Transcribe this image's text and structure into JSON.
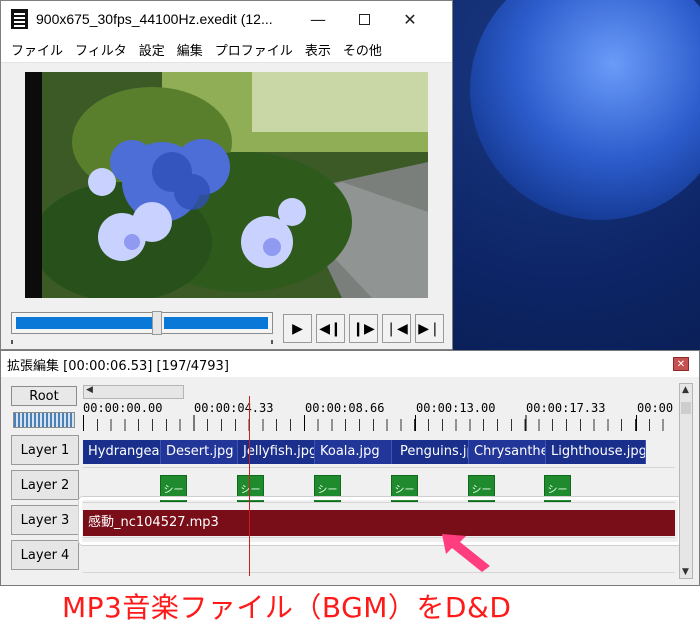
{
  "preview": {
    "title": "900x675_30fps_44100Hz.exedit (12...",
    "controls": {
      "minimize": "—",
      "close": "✕"
    },
    "menu": [
      "ファイル",
      "フィルタ",
      "設定",
      "編集",
      "プロファイル",
      "表示",
      "その他"
    ],
    "seek_fraction": 0.53,
    "buttons": [
      "▶",
      "◀❙",
      "❙▶",
      "❘◀",
      "▶❘"
    ]
  },
  "timeline": {
    "title": "拡張編集 [00:00:06.53] [197/4793]",
    "close_label": "✕",
    "root_label": "Root",
    "ruler": [
      "00:00:00.00",
      "00:00:04.33",
      "00:00:08.66",
      "00:00:13.00",
      "00:00:17.33",
      "00:00"
    ],
    "layers": [
      "Layer 1",
      "Layer 2",
      "Layer 3",
      "Layer 4"
    ],
    "image_clips": [
      "Hydrangea",
      "Desert.jpg",
      "Jellyfish.jpg",
      "Koala.jpg",
      "Penguins.jpg",
      "Chrysanthe",
      "Lighthouse.jpg"
    ],
    "transition_label": "シー",
    "audio_clip": "感動_nc104527.mp3"
  },
  "caption": "MP3音楽ファイル（BGM）をD&D",
  "colors": {
    "accent": "#0a78d7",
    "image_clip": "#1a2f8c",
    "transition_clip": "#1f8a2e",
    "audio_clip": "#7a0e18",
    "caption": "#ff1a1a",
    "arrow": "#ff3d7f"
  }
}
